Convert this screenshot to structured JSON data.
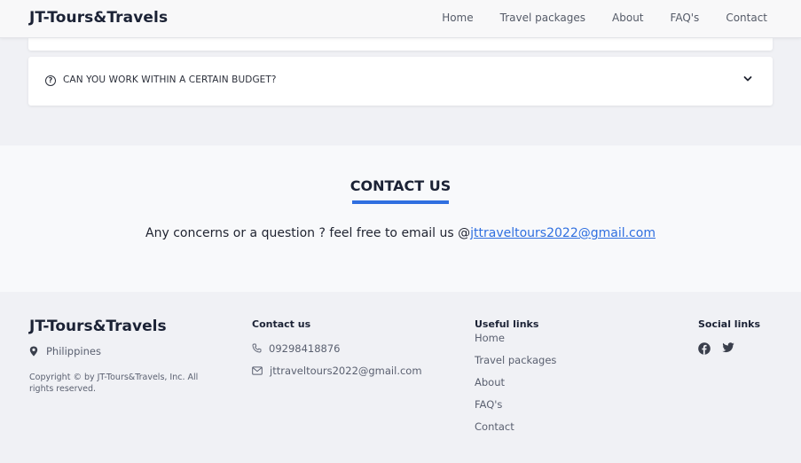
{
  "header": {
    "logo": "JT-Tours&Travels",
    "nav": [
      "Home",
      "Travel packages",
      "About",
      "FAQ's",
      "Contact"
    ]
  },
  "faq": {
    "question": "CAN YOU WORK WITHIN A CERTAIN BUDGET?"
  },
  "contact": {
    "title": "CONTACT US",
    "text": "Any concerns or a question ? feel free to email us @",
    "email": "jttraveltours2022@gmail.com",
    "accent_color": "#2f6fe0"
  },
  "footer": {
    "logo": "JT-Tours&Travels",
    "location": "Philippines",
    "copyright": "Copyright © by JT-Tours&Travels, Inc. All rights reserved.",
    "contact_heading": "Contact us",
    "phone": "09298418876",
    "email": "jttraveltours2022@gmail.com",
    "links_heading": "Useful links",
    "links": [
      "Home",
      "Travel packages",
      "About",
      "FAQ's",
      "Contact"
    ],
    "social_heading": "Social links",
    "social_icons": [
      "facebook-icon",
      "twitter-icon"
    ]
  }
}
